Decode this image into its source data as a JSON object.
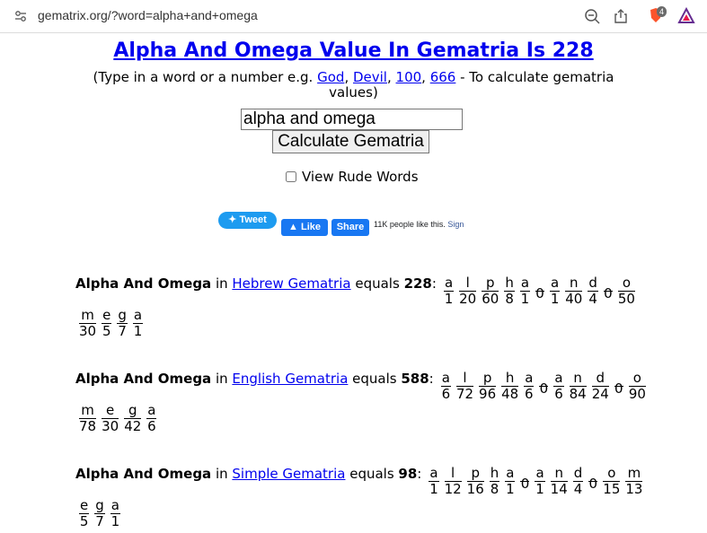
{
  "browser": {
    "url": "gematrix.org/?word=alpha+and+omega",
    "shield_count": "4"
  },
  "page": {
    "title": "Alpha And Omega Value In Gematria Is 228",
    "subtitle_pre": "(Type in a word or a number e.g. ",
    "examples": [
      "God",
      "Devil",
      "100",
      "666"
    ],
    "subtitle_post": " - To calculate gematria values)",
    "input_value": "alpha and omega",
    "calc_button": "Calculate Gematria",
    "rude_label": "View Rude Words"
  },
  "social": {
    "tweet": "Tweet",
    "like": "Like",
    "share": "Share",
    "like_count_text": "11K people like this.",
    "sign": "Sign"
  },
  "results": [
    {
      "phrase": "Alpha And Omega",
      "in": "in",
      "cipher": "Hebrew Gematria",
      "equals": "equals",
      "total": "228",
      "line1": [
        [
          "a",
          "1"
        ],
        [
          "l",
          "20"
        ],
        [
          "p",
          "60"
        ],
        [
          "h",
          "8"
        ],
        [
          "a",
          "1"
        ],
        [
          " ",
          "0"
        ],
        [
          "a",
          "1"
        ],
        [
          "n",
          "40"
        ],
        [
          "d",
          "4"
        ],
        [
          " ",
          "0"
        ],
        [
          "o",
          "50"
        ]
      ],
      "line2": [
        [
          "m",
          "30"
        ],
        [
          "e",
          "5"
        ],
        [
          "g",
          "7"
        ],
        [
          "a",
          "1"
        ]
      ]
    },
    {
      "phrase": "Alpha And Omega",
      "in": "in",
      "cipher": "English Gematria",
      "equals": "equals",
      "total": "588",
      "line1": [
        [
          "a",
          "6"
        ],
        [
          "l",
          "72"
        ],
        [
          "p",
          "96"
        ],
        [
          "h",
          "48"
        ],
        [
          "a",
          "6"
        ],
        [
          " ",
          "0"
        ],
        [
          "a",
          "6"
        ],
        [
          "n",
          "84"
        ],
        [
          "d",
          "24"
        ],
        [
          " ",
          "0"
        ],
        [
          "o",
          "90"
        ]
      ],
      "line2": [
        [
          "m",
          "78"
        ],
        [
          "e",
          "30"
        ],
        [
          "g",
          "42"
        ],
        [
          "a",
          "6"
        ]
      ]
    },
    {
      "phrase": "Alpha And Omega",
      "in": "in",
      "cipher": "Simple Gematria",
      "equals": "equals",
      "total": "98",
      "line1": [
        [
          "a",
          "1"
        ],
        [
          "l",
          "12"
        ],
        [
          "p",
          "16"
        ],
        [
          "h",
          "8"
        ],
        [
          "a",
          "1"
        ],
        [
          " ",
          "0"
        ],
        [
          "a",
          "1"
        ],
        [
          "n",
          "14"
        ],
        [
          "d",
          "4"
        ],
        [
          " ",
          "0"
        ],
        [
          "o",
          "15"
        ],
        [
          "m",
          "13"
        ]
      ],
      "line2": [
        [
          "e",
          "5"
        ],
        [
          "g",
          "7"
        ],
        [
          "a",
          "1"
        ]
      ]
    }
  ]
}
